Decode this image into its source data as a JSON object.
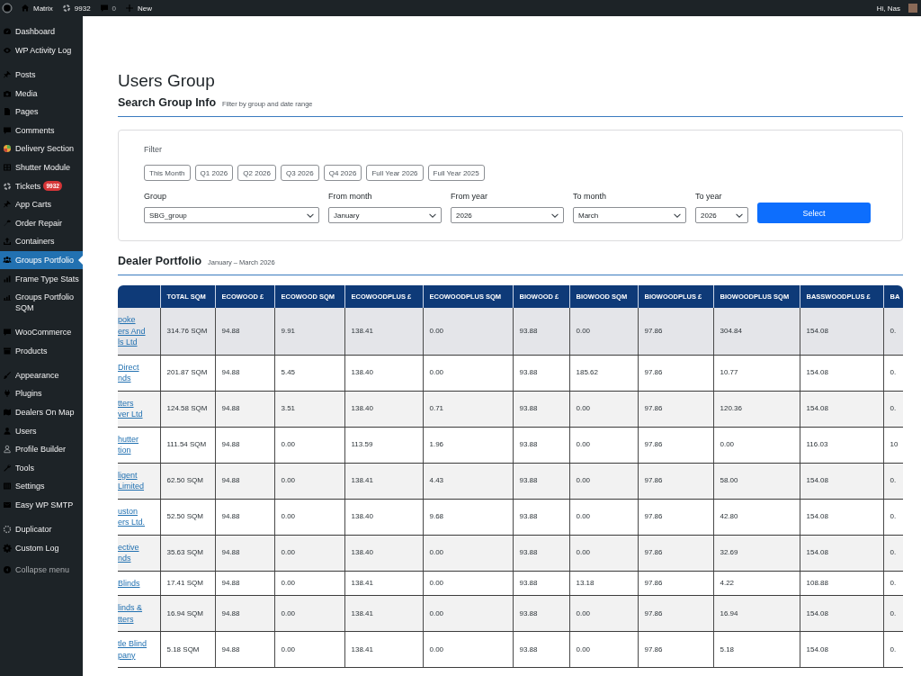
{
  "admin_bar": {
    "site_name": "Matrix",
    "tickets_count": "9932",
    "comments_count": "0",
    "new_label": "New",
    "greeting": "Hi, Nas"
  },
  "sidebar": {
    "groups": [
      [
        {
          "label": "Dashboard",
          "selected": false
        },
        {
          "label": "WP Activity Log",
          "selected": false
        }
      ],
      [
        {
          "label": "Posts",
          "selected": false
        },
        {
          "label": "Media",
          "selected": false
        },
        {
          "label": "Pages",
          "selected": false
        },
        {
          "label": "Comments",
          "selected": false
        },
        {
          "label": "Delivery Section",
          "selected": false
        },
        {
          "label": "Shutter Module",
          "selected": false
        },
        {
          "label": "Tickets",
          "selected": false,
          "badge": "9932"
        },
        {
          "label": "App Carts",
          "selected": false
        },
        {
          "label": "Order Repair",
          "selected": false
        },
        {
          "label": "Containers",
          "selected": false
        },
        {
          "label": "Groups Portfolio",
          "selected": true
        },
        {
          "label": "Frame Type Stats",
          "selected": false
        },
        {
          "label": "Groups Portfolio SQM",
          "selected": false
        }
      ],
      [
        {
          "label": "WooCommerce",
          "selected": false
        },
        {
          "label": "Products",
          "selected": false
        }
      ],
      [
        {
          "label": "Appearance",
          "selected": false
        },
        {
          "label": "Plugins",
          "selected": false
        },
        {
          "label": "Dealers On Map",
          "selected": false
        },
        {
          "label": "Users",
          "selected": false
        },
        {
          "label": "Profile Builder",
          "selected": false
        },
        {
          "label": "Tools",
          "selected": false
        },
        {
          "label": "Settings",
          "selected": false
        },
        {
          "label": "Easy WP SMTP",
          "selected": false
        }
      ],
      [
        {
          "label": "Duplicator",
          "selected": false
        },
        {
          "label": "Custom Log",
          "selected": false
        }
      ]
    ],
    "collapse_label": "Collapse menu"
  },
  "page": {
    "title": "Users Group"
  },
  "search_section": {
    "title": "Search Group Info",
    "subtitle": "Filter by group and date range"
  },
  "filter": {
    "label": "Filter",
    "presets": [
      "This Month",
      "Q1 2026",
      "Q2 2026",
      "Q3 2026",
      "Q4 2026",
      "Full Year 2026",
      "Full Year 2025"
    ],
    "fields": [
      {
        "label": "Group",
        "value": "SBG_group"
      },
      {
        "label": "From month",
        "value": "January"
      },
      {
        "label": "From year",
        "value": "2026"
      },
      {
        "label": "To month",
        "value": "March"
      },
      {
        "label": "To year",
        "value": "2026"
      }
    ],
    "button": "Select"
  },
  "portfolio": {
    "title": "Dealer Portfolio",
    "subtitle": "January – March 2026"
  },
  "table": {
    "columns": [
      "TOTAL SQM",
      "ECOWOOD £",
      "ECOWOOD SQM",
      "ECOWOODPLUS £",
      "ECOWOODPLUS SQM",
      "BIOWOOD £",
      "BIOWOOD SQM",
      "BIOWOODPLUS £",
      "BIOWOODPLUS SQM",
      "BASSWOODPLUS £",
      "BA"
    ],
    "rows": [
      {
        "name": "poke\ners And\nls Ltd",
        "hovered": true,
        "cells": [
          "314.76 SQM",
          "94.88",
          "9.91",
          "138.41",
          "0.00",
          "93.88",
          "0.00",
          "97.86",
          "304.84",
          "154.08",
          "0."
        ]
      },
      {
        "name": "Direct\nnds",
        "hovered": false,
        "cells": [
          "201.87 SQM",
          "94.88",
          "5.45",
          "138.40",
          "0.00",
          "93.88",
          "185.62",
          "97.86",
          "10.77",
          "154.08",
          "0."
        ]
      },
      {
        "name": "tters\nver Ltd",
        "hovered": false,
        "cells": [
          "124.58 SQM",
          "94.88",
          "3.51",
          "138.40",
          "0.71",
          "93.88",
          "0.00",
          "97.86",
          "120.36",
          "154.08",
          "0."
        ]
      },
      {
        "name": "hutter\ntion",
        "hovered": false,
        "cells": [
          "111.54 SQM",
          "94.88",
          "0.00",
          "113.59",
          "1.96",
          "93.88",
          "0.00",
          "97.86",
          "0.00",
          "116.03",
          "10"
        ]
      },
      {
        "name": "ligent\nLimited",
        "hovered": false,
        "cells": [
          "62.50 SQM",
          "94.88",
          "0.00",
          "138.41",
          "4.43",
          "93.88",
          "0.00",
          "97.86",
          "58.00",
          "154.08",
          "0."
        ]
      },
      {
        "name": "uston\ners Ltd.",
        "hovered": false,
        "cells": [
          "52.50 SQM",
          "94.88",
          "0.00",
          "138.40",
          "9.68",
          "93.88",
          "0.00",
          "97.86",
          "42.80",
          "154.08",
          "0."
        ]
      },
      {
        "name": "ective\nnds",
        "hovered": false,
        "cells": [
          "35.63 SQM",
          "94.88",
          "0.00",
          "138.40",
          "0.00",
          "93.88",
          "0.00",
          "97.86",
          "32.69",
          "154.08",
          "0."
        ]
      },
      {
        "name": "Blinds",
        "hovered": false,
        "cells": [
          "17.41 SQM",
          "94.88",
          "0.00",
          "138.41",
          "0.00",
          "93.88",
          "13.18",
          "97.86",
          "4.22",
          "108.88",
          "0."
        ]
      },
      {
        "name": "linds &\ntters",
        "hovered": false,
        "cells": [
          "16.94 SQM",
          "94.88",
          "0.00",
          "138.41",
          "0.00",
          "93.88",
          "0.00",
          "97.86",
          "16.94",
          "154.08",
          "0."
        ]
      },
      {
        "name": "tle Blind\npany",
        "hovered": false,
        "cells": [
          "5.18 SQM",
          "94.88",
          "0.00",
          "138.41",
          "0.00",
          "93.88",
          "0.00",
          "97.86",
          "5.18",
          "154.08",
          "0."
        ]
      }
    ]
  }
}
